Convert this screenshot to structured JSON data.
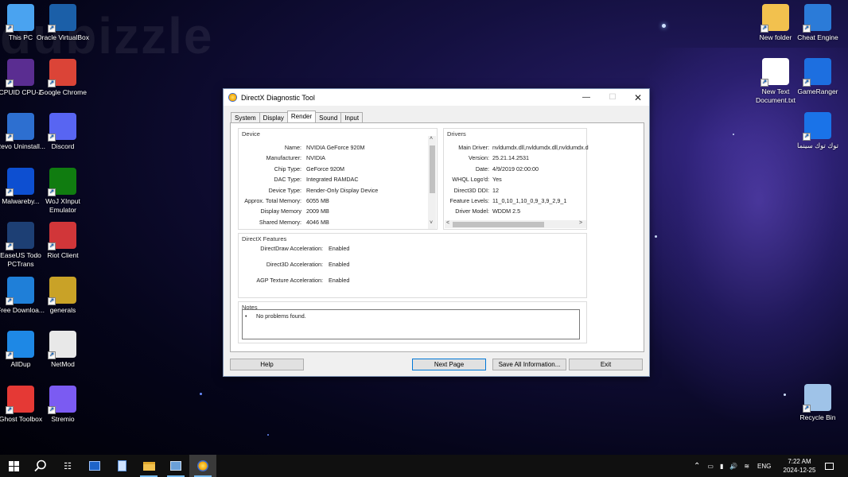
{
  "desktop": {
    "watermark": "dubizzle",
    "icons_left": [
      {
        "label": "This PC",
        "icon": "computer-icon",
        "color": "#4aa3f0"
      },
      {
        "label": "Oracle VirtualBox",
        "icon": "virtualbox-icon",
        "color": "#1b5fa8"
      },
      {
        "label": "CPUID CPU-Z",
        "icon": "cpu-z-icon",
        "color": "#5a2d91"
      },
      {
        "label": "Google Chrome",
        "icon": "chrome-icon",
        "color": "#db4437"
      },
      {
        "label": "Revo Uninstall...",
        "icon": "revo-icon",
        "color": "#2d6fd0"
      },
      {
        "label": "Discord",
        "icon": "discord-icon",
        "color": "#5865f2"
      },
      {
        "label": "Malwareby...",
        "icon": "malwarebytes-icon",
        "color": "#0d4fd1"
      },
      {
        "label": "WoJ XInput Emulator",
        "icon": "woj-icon",
        "color": "#107c10"
      },
      {
        "label": "EaseUS Todo PCTrans",
        "icon": "easeus-icon",
        "color": "#1d3f74"
      },
      {
        "label": "Riot Client",
        "icon": "riot-icon",
        "color": "#d13639"
      },
      {
        "label": "Free Downloa...",
        "icon": "download-icon",
        "color": "#1f7fd8"
      },
      {
        "label": "generals",
        "icon": "generals-icon",
        "color": "#c9a227"
      },
      {
        "label": "AllDup",
        "icon": "alldup-icon",
        "color": "#1e88e5"
      },
      {
        "label": "NetMod",
        "icon": "netmod-icon",
        "color": "#e8e8e8"
      },
      {
        "label": "Ghost Toolbox",
        "icon": "ghost-toolbox-icon",
        "color": "#e53935"
      },
      {
        "label": "Stremio",
        "icon": "stremio-icon",
        "color": "#7b5bf2"
      }
    ],
    "icons_right": [
      {
        "label": "New folder",
        "icon": "folder-icon",
        "color": "#f2c14e"
      },
      {
        "label": "Cheat Engine",
        "icon": "cheat-engine-icon",
        "color": "#2b7bd8"
      },
      {
        "label": "New Text Document.txt",
        "icon": "text-file-icon",
        "color": "#ffffff"
      },
      {
        "label": "GameRanger",
        "icon": "gameranger-icon",
        "color": "#1d6fe0"
      },
      {
        "label": "توك توك سينما",
        "icon": "tuktuk-icon",
        "color": "#1a73e8"
      },
      {
        "label": "Recycle Bin",
        "icon": "recycle-bin-icon",
        "color": "#9fc3e8"
      }
    ]
  },
  "window": {
    "title": "DirectX Diagnostic Tool",
    "tabs": [
      "System",
      "Display",
      "Render",
      "Sound",
      "Input"
    ],
    "active_tab": "Render",
    "device": {
      "title": "Device",
      "rows": [
        {
          "label": "Name:",
          "value": "NVIDIA GeForce 920M"
        },
        {
          "label": "Manufacturer:",
          "value": "NVIDIA"
        },
        {
          "label": "Chip Type:",
          "value": "GeForce 920M"
        },
        {
          "label": "DAC Type:",
          "value": "Integrated RAMDAC"
        },
        {
          "label": "Device Type:",
          "value": "Render-Only Display Device"
        },
        {
          "label": "Approx. Total Memory:",
          "value": "6055 MB"
        },
        {
          "label": "Display Memory",
          "value": "2009 MB"
        },
        {
          "label": "Shared Memory:",
          "value": "4046 MB"
        }
      ]
    },
    "drivers": {
      "title": "Drivers",
      "rows": [
        {
          "label": "Main Driver:",
          "value": "nvldumdx.dll,nvldumdx.dll,nvldumdx.d"
        },
        {
          "label": "Version:",
          "value": "25.21.14.2531"
        },
        {
          "label": "Date:",
          "value": "4/9/2019 02:00:00"
        },
        {
          "label": "WHQL Logo'd:",
          "value": "Yes"
        },
        {
          "label": "Direct3D DDI:",
          "value": "12"
        },
        {
          "label": "Feature Levels:",
          "value": "11_0,10_1,10_0,9_3,9_2,9_1"
        },
        {
          "label": "Driver Model:",
          "value": "WDDM 2.5"
        }
      ]
    },
    "features": {
      "title": "DirectX Features",
      "rows": [
        {
          "label": "DirectDraw Acceleration:",
          "value": "Enabled"
        },
        {
          "label": "Direct3D Acceleration:",
          "value": "Enabled"
        },
        {
          "label": "AGP Texture Acceleration:",
          "value": "Enabled"
        }
      ]
    },
    "notes": {
      "title": "Notes",
      "bullet": "•",
      "text": "No problems found."
    },
    "buttons": {
      "help": "Help",
      "next": "Next Page",
      "save": "Save All Information...",
      "exit": "Exit"
    }
  },
  "taskbar": {
    "lang": "ENG",
    "time": "7:22 AM",
    "date": "2024-12-25"
  }
}
